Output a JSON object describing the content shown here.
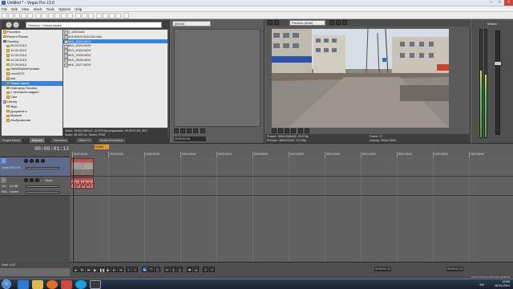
{
  "window": {
    "title": "Untitled * - Vegas Pro 13.0",
    "buttons": [
      "–",
      "□",
      "×"
    ]
  },
  "menu": [
    "File",
    "Edit",
    "View",
    "Insert",
    "Tools",
    "Options",
    "Help"
  ],
  "explorer": {
    "path": "Desktop › Новая папка",
    "tree": [
      "Favorites",
      "Recent Places",
      "Desktop",
      "06.03.2013",
      "11.09.2013",
      "12.09.2013",
      "12.09.2013",
      "22.09.2013",
      "DMWIRpilotPortable",
      "LevelDTS",
      "wat",
      "Новая папка",
      "Новгород Псковск",
      "с телефона видкен",
      "Сам",
      "Library",
      "Звук",
      "Документы",
      "Музыка",
      "Изображения"
    ],
    "selected_tree_index": 11,
    "files": [
      "1_D59.m4s",
      "20140403 0044 59.m2s",
      "MVI_2022.MOV",
      "MVI_2023.MOV",
      "MVI_2024.MOV",
      "MVI_2025.MOV",
      "MVI_2026.MOV",
      "MVI_2027.MOV"
    ],
    "selected_file_index": 2,
    "file_info_line1": "Video: 1920x1080x12, 23,976 fps progressive, 00:00:07:03, AVC",
    "file_info_line2": "Audio: 48 000 Hz, Stereo, PCM",
    "tabs": [
      "Project Media",
      "Explorer",
      "Transitions",
      "Video FX",
      "Media Generators"
    ],
    "active_tab": 1
  },
  "trimmer": {
    "dropdown": "(None)",
    "time": "00:00:01:04"
  },
  "preview": {
    "mode": "Preview (Auto)",
    "project_label": "Project:",
    "project_value": "1920x1080x32, 23,976p",
    "preview_label": "Preview:",
    "preview_value": "480x270x32, 23,976p",
    "frame_label": "Frame:",
    "frame_value": "27",
    "display_label": "Display:",
    "display_value": "254x178x32"
  },
  "meters": {
    "label": "Master",
    "levels": [
      0.62,
      0.58
    ]
  },
  "timeline": {
    "timecode": "00:00:01:13",
    "marker": "Marker",
    "ruler_labels": [
      "00:00:00:00",
      "00:00:10:00",
      "00:00:20:00",
      "00:00:30:00",
      "00:00:40:00",
      "00:00:50:00",
      "00:01:00:00",
      "00:01:10:00",
      "00:01:20:00",
      "00:01:30:00",
      "00:01:40:00",
      "00:01:50:00"
    ],
    "tracks": [
      {
        "num": "1",
        "type": "video",
        "level_label": "Level:",
        "level_value": "100,0 %"
      },
      {
        "num": "2",
        "type": "audio",
        "vol_label": "Vol:",
        "vol_value": "0,0 dB",
        "pan_label": "Pan:",
        "pan_value": "Center",
        "touch": "Touch"
      }
    ]
  },
  "transport": {
    "rate": "Rate: 0,00",
    "time_left": "00:00:01:13",
    "time_right": "00:00:01:13"
  },
  "status": {
    "record_time": "Record Time (2 channels): 69:30:46"
  },
  "taskbar": {
    "language": "EN",
    "time": "23:59",
    "date": "18.04.2014"
  }
}
